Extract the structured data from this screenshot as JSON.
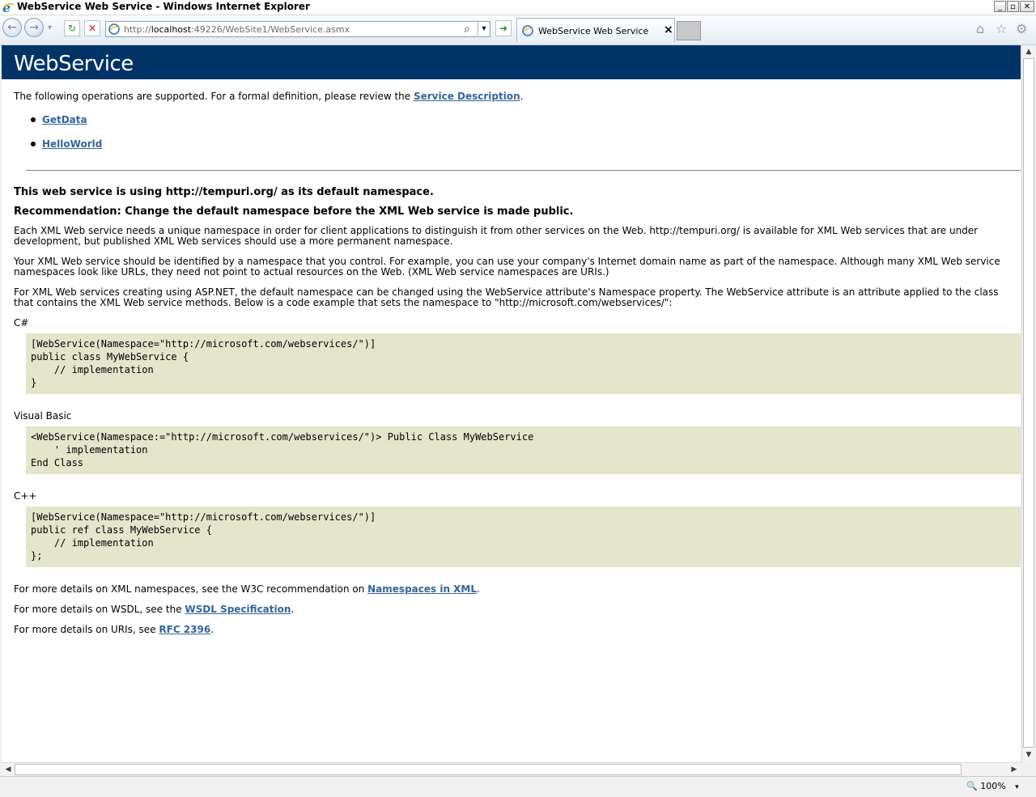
{
  "window": {
    "title": "WebService Web Service - Windows Internet Explorer",
    "minimize": "_",
    "restore": "▫",
    "close": "✕"
  },
  "nav": {
    "back_icon": "←",
    "forward_icon": "→",
    "refresh_icon": "↻",
    "stop_icon": "✕",
    "go_icon": "➜",
    "url_prefix": "http://",
    "url_host": "localhost",
    "url_rest": ":49226/WebSite1/WebService.asmx",
    "search_icon": "⌕",
    "dropdown_icon": "▾"
  },
  "tab": {
    "title": "WebService Web Service",
    "close": "×"
  },
  "toolbar_icons": {
    "home": "⌂",
    "favorites": "☆",
    "tools": "⚙"
  },
  "page": {
    "heading": "WebService",
    "intro_text": "The following operations are supported. For a formal definition, please review the ",
    "intro_link": "Service Description",
    "intro_end": ".",
    "operations": [
      "GetData",
      "HelloWorld"
    ],
    "namespace_line": "This web service is using http://tempuri.org/ as its default namespace.",
    "recommendation": "Recommendation: Change the default namespace before the XML Web service is made public.",
    "para1": "Each XML Web service needs a unique namespace in order for client applications to distinguish it from other services on the Web. http://tempuri.org/ is available for XML Web services that are under development, but published XML Web services should use a more permanent namespace.",
    "para2": "Your XML Web service should be identified by a namespace that you control. For example, you can use your company's Internet domain name as part of the namespace. Although many XML Web service namespaces look like URLs, they need not point to actual resources on the Web. (XML Web service namespaces are URIs.)",
    "para3": "For XML Web services creating using ASP.NET, the default namespace can be changed using the WebService attribute's Namespace property. The WebService attribute is an attribute applied to the class that contains the XML Web service methods. Below is a code example that sets the namespace to \"http://microsoft.com/webservices/\":",
    "csharp_label": "C#",
    "csharp_code": "[WebService(Namespace=\"http://microsoft.com/webservices/\")]\npublic class MyWebService {\n    // implementation\n}",
    "vb_label": "Visual Basic",
    "vb_code": "<WebService(Namespace:=\"http://microsoft.com/webservices/\")> Public Class MyWebService\n    ' implementation\nEnd Class",
    "cpp_label": "C++",
    "cpp_code": "[WebService(Namespace=\"http://microsoft.com/webservices/\")]\npublic ref class MyWebService {\n    // implementation\n};",
    "more_xml_text": "For more details on XML namespaces, see the W3C recommendation on ",
    "more_xml_link": "Namespaces in XML",
    "more_wsdl_text": "For more details on WSDL, see the ",
    "more_wsdl_link": "WSDL Specification",
    "more_uri_text": "For more details on URIs, see ",
    "more_uri_link": "RFC 2396",
    "period": "."
  },
  "status": {
    "zoom": "100%",
    "zoom_dropdown": "▾"
  },
  "colors": {
    "heading_bg": "#003366",
    "link": "#336699",
    "code_bg": "#e5e5cc"
  }
}
